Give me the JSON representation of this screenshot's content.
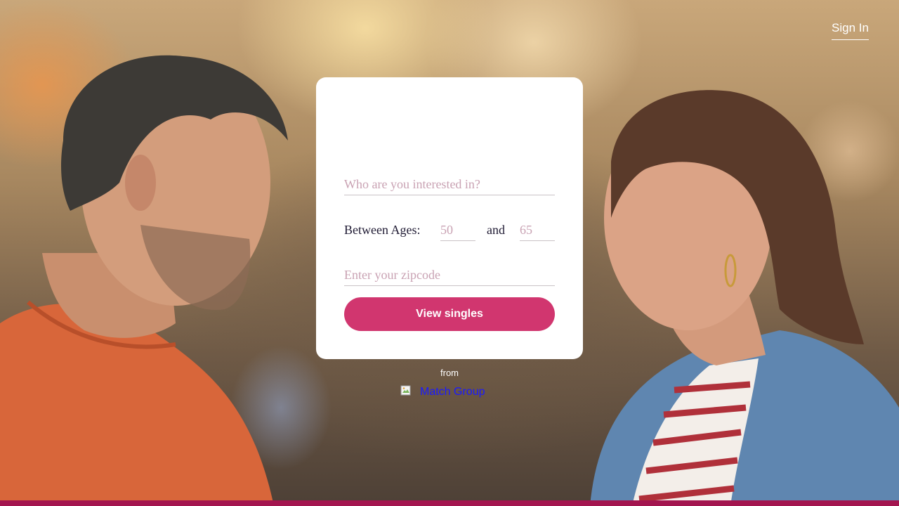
{
  "header": {
    "sign_in_label": "Sign In"
  },
  "form": {
    "interest_placeholder": "Who are you interested in?",
    "ages_label": "Between Ages:",
    "age_min_placeholder": "50",
    "ages_and": "and",
    "age_max_placeholder": "65",
    "zip_placeholder": "Enter your zipcode",
    "submit_label": "View singles"
  },
  "footer": {
    "from_label": "from",
    "brand_alt": "Match Group"
  },
  "colors": {
    "accent": "#d1366f",
    "bottom_bar": "#a3154f",
    "placeholder": "#c9a2b3",
    "link": "#1a1aff"
  }
}
